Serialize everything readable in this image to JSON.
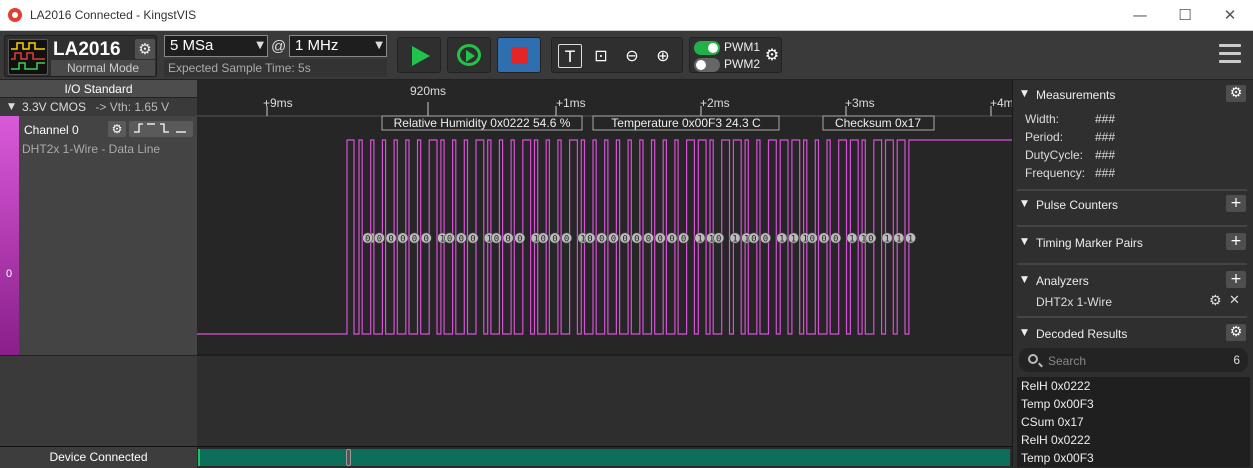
{
  "window": {
    "title": "LA2016 Connected - KingstVIS",
    "minimize_glyph": "—",
    "maximize_glyph": "☐",
    "close_glyph": "✕"
  },
  "device": {
    "name": "LA2016",
    "mode": "Normal Mode",
    "settings_icon": "gear-icon"
  },
  "sampling": {
    "sample_depth": "5 MSa",
    "at": "@",
    "sample_rate": "1 MHz",
    "expected_time": "Expected Sample Time: 5s"
  },
  "tools": {
    "text_glyph": "T",
    "zoom_fit_glyph": "⊡",
    "zoom_out_glyph": "⊖",
    "zoom_in_glyph": "⊕"
  },
  "pwm": {
    "pwm1_label": "PWM1",
    "pwm1_on": true,
    "pwm2_label": "PWM2",
    "pwm2_on": false
  },
  "io": {
    "header": "I/O Standard",
    "standard": "3.3V CMOS",
    "vth": "-> Vth:  1.65 V"
  },
  "channel": {
    "name": "Channel 0",
    "index": "0",
    "description": "DHT2x 1-Wire - Data Line",
    "edge_glyphs": "⨍ ‾ ⨌ _"
  },
  "timeline": {
    "ticks": [
      "+9ms",
      "+1ms",
      "+2ms",
      "+3ms",
      "+4m"
    ],
    "marker_label": "920ms"
  },
  "decode_labels": [
    "Relative Humidity 0x0222 54.6 %",
    "Temperature 0x00F3 24.3 C",
    "Checksum 0x17"
  ],
  "bits": "00000010001000100010000000001101100111000110111",
  "status": {
    "text": "Device Connected"
  },
  "right_panel": {
    "measurements": {
      "title": "Measurements",
      "rows": [
        {
          "label": "Width:",
          "value": "###"
        },
        {
          "label": "Period:",
          "value": "###"
        },
        {
          "label": "DutyCycle:",
          "value": "###"
        },
        {
          "label": "Frequency:",
          "value": "###"
        }
      ]
    },
    "pulse_counters": {
      "title": "Pulse Counters"
    },
    "timing_pairs": {
      "title": "Timing Marker Pairs"
    },
    "analyzers": {
      "title": "Analyzers",
      "items": [
        "DHT2x 1-Wire"
      ]
    },
    "decoded": {
      "title": "Decoded Results",
      "search_placeholder": "Search",
      "count": "6",
      "results": [
        "RelH 0x0222",
        "Temp 0x00F3",
        "CSum 0x17",
        "RelH 0x0222",
        "Temp 0x00F3"
      ]
    }
  },
  "colors": {
    "signal": "#d94fd9",
    "play_green": "#22c34a",
    "stop_red": "#e22525",
    "stop_bg_blue": "#2f6fb0",
    "overview_teal": "#0d6e5a"
  }
}
